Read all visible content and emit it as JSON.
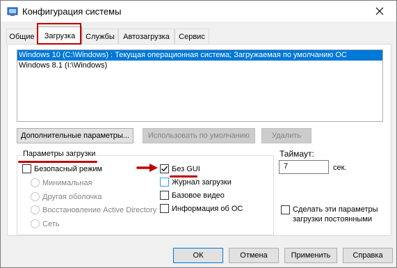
{
  "window": {
    "title": "Конфигурация системы",
    "icons": {
      "app": "msconfig-icon",
      "close": "close-icon"
    }
  },
  "tabs": [
    {
      "label": "Общие"
    },
    {
      "label": "Загрузка"
    },
    {
      "label": "Службы"
    },
    {
      "label": "Автозагрузка"
    },
    {
      "label": "Сервис"
    }
  ],
  "active_tab": "Загрузка",
  "os_list": [
    {
      "label": "Windows 10 (C:\\Windows) : Текущая операционная система; Загружаемая по умолчанию ОС",
      "selected": true
    },
    {
      "label": "Windows 8.1 (I:\\Windows)",
      "selected": false
    }
  ],
  "buttons": {
    "advanced": "Дополнительные параметры...",
    "set_default": "Использовать по умолчанию",
    "delete": "Удалить",
    "ok": "ОК",
    "cancel": "Отмена",
    "apply": "Применить",
    "help": "Справка"
  },
  "boot_options": {
    "group_label": "Параметры загрузки",
    "safe_boot": {
      "label": "Безопасный режим",
      "checked": false
    },
    "safe_modes": [
      "Минимальная",
      "Другая оболочка",
      "Восстановление Active Directory",
      "Сеть"
    ],
    "no_gui": {
      "label": "Без GUI",
      "checked": true
    },
    "boot_log": {
      "label": "Журнал загрузки",
      "checked": false
    },
    "base_video": {
      "label": "Базовое видео",
      "checked": false
    },
    "os_boot_info": {
      "label": "Информация  об ОС",
      "checked": false
    }
  },
  "timeout": {
    "label": "Таймаут:",
    "value": "7",
    "unit": "сек."
  },
  "make_permanent": {
    "label_line1": "Сделать эти параметры",
    "label_line2": "загрузки постоянными",
    "checked": false
  },
  "colors": {
    "selection": "#0078d7",
    "annotation": "#c00000"
  }
}
